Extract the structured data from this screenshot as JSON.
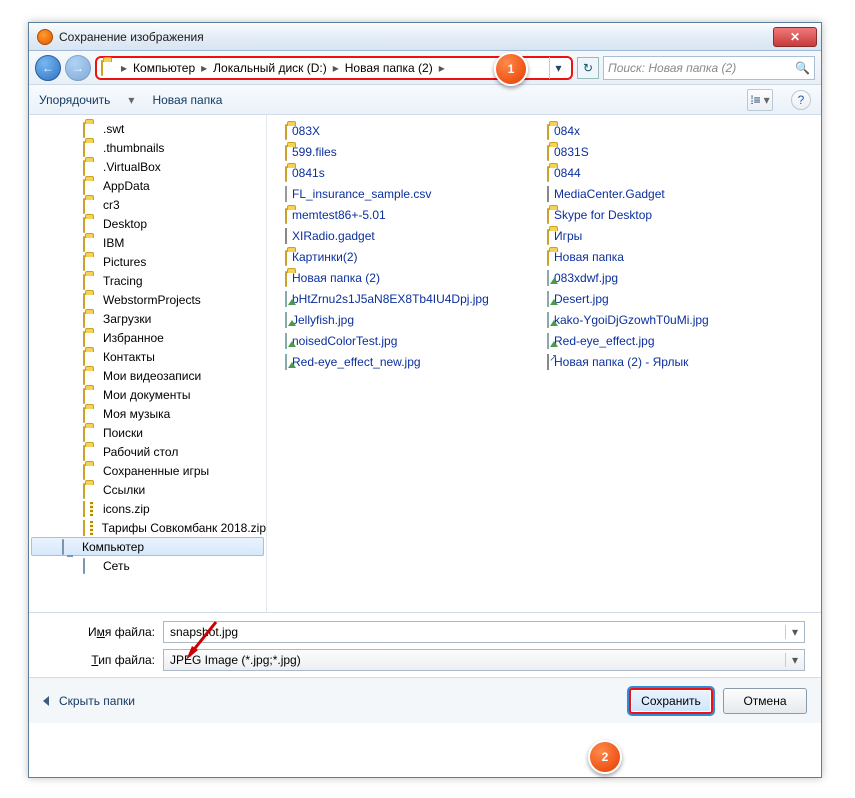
{
  "window": {
    "title": "Сохранение изображения"
  },
  "nav": {
    "crumbs": [
      "Компьютер",
      "Локальный диск (D:)",
      "Новая папка (2)"
    ],
    "search_placeholder": "Поиск: Новая папка (2)"
  },
  "toolbar": {
    "organize": "Упорядочить",
    "new_folder": "Новая папка"
  },
  "tree": [
    ".swt",
    ".thumbnails",
    ".VirtualBox",
    "AppData",
    "cr3",
    "Desktop",
    "IBM",
    "Pictures",
    "Tracing",
    "WebstormProjects",
    "Загрузки",
    "Избранное",
    "Контакты",
    "Мои видеозаписи",
    "Мои документы",
    "Моя музыка",
    "Поиски",
    "Рабочий стол",
    "Сохраненные игры",
    "Ссылки",
    "icons.zip",
    "Тарифы Совкомбанк 2018.zip",
    "Компьютер",
    "Сеть"
  ],
  "tree_kinds": [
    "f",
    "f",
    "f",
    "f",
    "f",
    "f",
    "f",
    "f",
    "f",
    "f",
    "f",
    "f",
    "f",
    "f",
    "f",
    "f",
    "f",
    "f",
    "f",
    "f",
    "zip",
    "zip",
    "comp",
    "net"
  ],
  "tree_selected_index": 22,
  "list_col1": [
    {
      "t": "083X",
      "k": "f"
    },
    {
      "t": "599.files",
      "k": "f"
    },
    {
      "t": "0841s",
      "k": "f"
    },
    {
      "t": "FL_insurance_sample.csv",
      "k": "csv"
    },
    {
      "t": "memtest86+-5.01",
      "k": "f"
    },
    {
      "t": "XIRadio.gadget",
      "k": "g"
    },
    {
      "t": "Картинки(2)",
      "k": "f"
    },
    {
      "t": "Новая папка (2)",
      "k": "f"
    },
    {
      "t": "bHtZrnu2s1J5aN8EX8Tb4IU4Dpj.jpg",
      "k": "i"
    },
    {
      "t": "Jellyfish.jpg",
      "k": "i"
    },
    {
      "t": "noisedColorTest.jpg",
      "k": "i"
    },
    {
      "t": "Red-eye_effect_new.jpg",
      "k": "i"
    }
  ],
  "list_col2": [
    {
      "t": "084x",
      "k": "f"
    },
    {
      "t": "0831S",
      "k": "f"
    },
    {
      "t": "0844",
      "k": "f"
    },
    {
      "t": "MediaCenter.Gadget",
      "k": "g"
    },
    {
      "t": "Skype for Desktop",
      "k": "f"
    },
    {
      "t": "Игры",
      "k": "f"
    },
    {
      "t": "Новая папка",
      "k": "f"
    },
    {
      "t": "083xdwf.jpg",
      "k": "i"
    },
    {
      "t": "Desert.jpg",
      "k": "i"
    },
    {
      "t": "kako-YgoiDjGzowhT0uMi.jpg",
      "k": "i"
    },
    {
      "t": "Red-eye_effect.jpg",
      "k": "i"
    },
    {
      "t": "Новая папка (2) - Ярлык",
      "k": "lnk"
    }
  ],
  "fields": {
    "filename_label_pre": "И",
    "filename_label_u": "м",
    "filename_label_post": "я файла:",
    "filetype_label_pre": "",
    "filetype_label_u": "Т",
    "filetype_label_post": "ип файла:",
    "filename_value": "snapshot.jpg",
    "filetype_value": "JPEG Image (*.jpg;*.jpg)"
  },
  "footer": {
    "hide_folders": "Скрыть папки",
    "save": "Сохранить",
    "cancel": "Отмена"
  },
  "badges": {
    "b1": "1",
    "b2": "2"
  }
}
